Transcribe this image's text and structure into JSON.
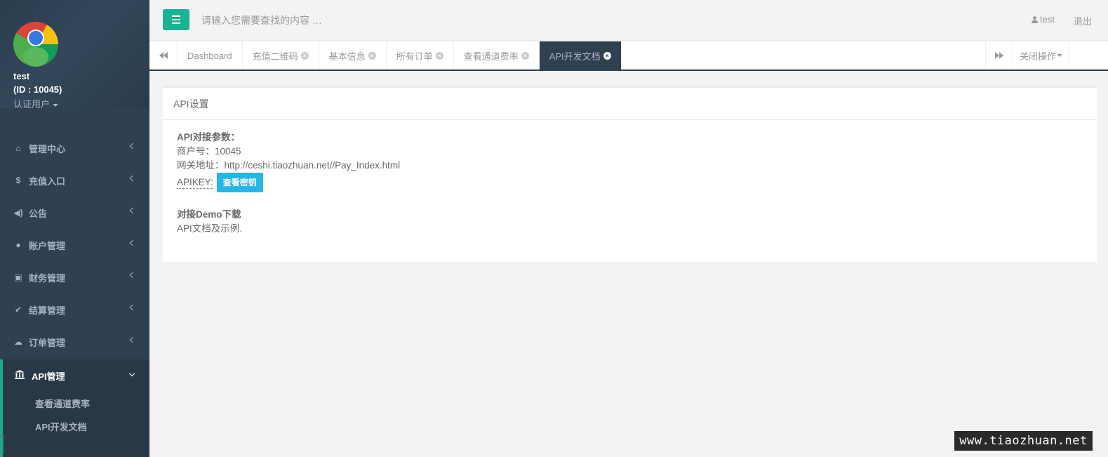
{
  "profile": {
    "name": "test",
    "id": "(ID : 10045)",
    "role": "认证用户"
  },
  "nav": {
    "items": [
      {
        "label": "管理中心",
        "icon": "home-icon",
        "glyph": "⌂"
      },
      {
        "label": "充值入口",
        "icon": "dollar-icon",
        "glyph": "$"
      },
      {
        "label": "公告",
        "icon": "volume-icon",
        "glyph": "◀)"
      },
      {
        "label": "账户管理",
        "icon": "user-icon",
        "glyph": "●"
      },
      {
        "label": "财务管理",
        "icon": "money-icon",
        "glyph": "▣"
      },
      {
        "label": "结算管理",
        "icon": "check-icon",
        "glyph": "✔"
      },
      {
        "label": "订单管理",
        "icon": "cloud-icon",
        "glyph": "☁"
      }
    ],
    "active": {
      "label": "API管理",
      "icon": "bank-icon",
      "glyph": "🏛",
      "subitems": [
        "查看通道费率",
        "API开发文档"
      ]
    }
  },
  "topbar": {
    "search_placeholder": "请输入您需要查找的内容 …",
    "user": "test",
    "logout": "退出"
  },
  "tabs": {
    "items": [
      "Dashboard",
      "充值二维码",
      "基本信息",
      "所有订单",
      "查看通道费率",
      "API开发文档"
    ],
    "close_ops": "关闭操作"
  },
  "panel": {
    "title": "API设置",
    "params_heading": "API对接参数：",
    "merchant": "商户号：10045",
    "gateway": "网关地址：http://ceshi.tiaozhuan.net//Pay_Index.html",
    "apikey_label": "APIKEY:",
    "view_key_button": "查看密钥",
    "demo_heading": "对接Demo下载",
    "demo_text": "API文档及示例."
  },
  "watermark": "www.tiaozhuan.net",
  "colors": {
    "sidebar": "#2f4050",
    "accent": "#1ab394",
    "key_button": "#23b7e5"
  }
}
